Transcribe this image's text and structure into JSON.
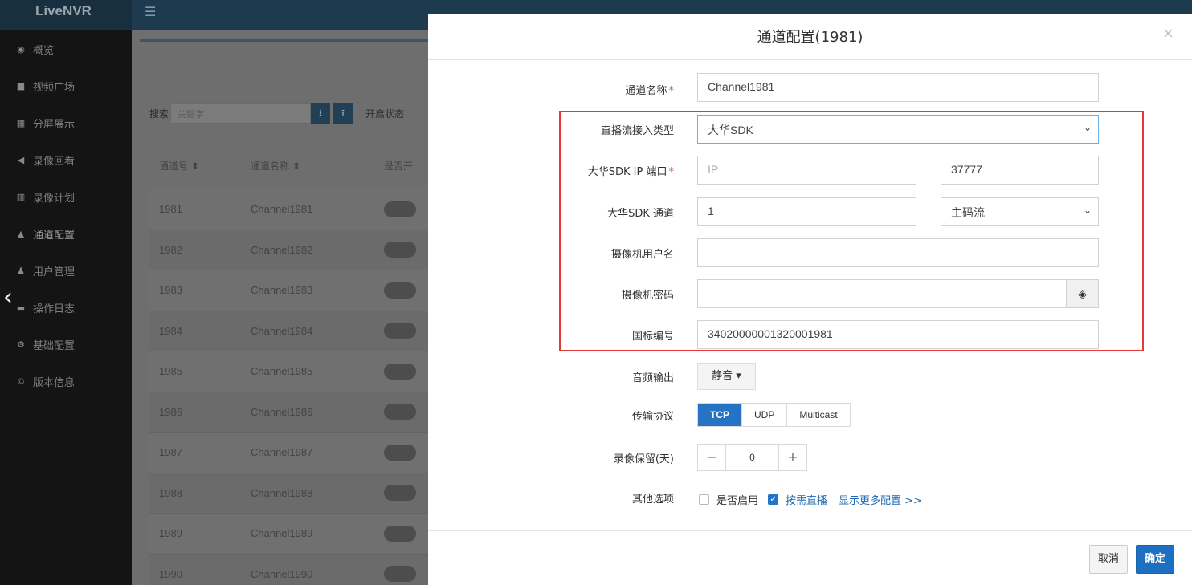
{
  "app": {
    "title": "LiveNVR",
    "menu_icon": "☰"
  },
  "sidebar": {
    "items": [
      {
        "label": "概览",
        "icon": "dashboard-icon",
        "glyph": "◉"
      },
      {
        "label": "视频广场",
        "icon": "video-camera-icon",
        "glyph": "■"
      },
      {
        "label": "分屏展示",
        "icon": "grid-icon",
        "glyph": "▦"
      },
      {
        "label": "录像回看",
        "icon": "backward-icon",
        "glyph": "◀"
      },
      {
        "label": "录像计划",
        "icon": "calendar-icon",
        "glyph": "▥"
      },
      {
        "label": "通道配置",
        "icon": "sitemap-icon",
        "glyph": "▲"
      },
      {
        "label": "用户管理",
        "icon": "users-icon",
        "glyph": "♟"
      },
      {
        "label": "操作日志",
        "icon": "file-icon",
        "glyph": "▬"
      },
      {
        "label": "基础配置",
        "icon": "gears-icon",
        "glyph": "⚙"
      },
      {
        "label": "版本信息",
        "icon": "copyright-icon",
        "glyph": "©"
      }
    ]
  },
  "toolbar": {
    "search_label": "搜索",
    "search_placeholder": "关键字",
    "download_icon": "⭳",
    "upload_icon": "⭱",
    "enable_label": "开启状态"
  },
  "table": {
    "headers": [
      "通道号 ⬍",
      "通道名称 ⬍",
      "是否开"
    ],
    "rows": [
      {
        "id": "1981",
        "name": "Channel1981"
      },
      {
        "id": "1982",
        "name": "Channel1982"
      },
      {
        "id": "1983",
        "name": "Channel1983"
      },
      {
        "id": "1984",
        "name": "Channel1984"
      },
      {
        "id": "1985",
        "name": "Channel1985"
      },
      {
        "id": "1986",
        "name": "Channel1986"
      },
      {
        "id": "1987",
        "name": "Channel1987"
      },
      {
        "id": "1988",
        "name": "Channel1988"
      },
      {
        "id": "1989",
        "name": "Channel1989"
      },
      {
        "id": "1990",
        "name": "Channel1990"
      }
    ]
  },
  "modal": {
    "title": "通道配置(1981)",
    "close": "×",
    "fields": {
      "channel_name": {
        "label": "通道名称",
        "required": "*",
        "value": "Channel1981"
      },
      "stream_type": {
        "label": "直播流接入类型",
        "value": "大华SDK"
      },
      "sdk_ip_port": {
        "label": "大华SDK IP 端口",
        "required": "*",
        "ip_placeholder": "IP",
        "port_value": "37777"
      },
      "sdk_channel": {
        "label": "大华SDK 通道",
        "value": "1",
        "stream_value": "主码流"
      },
      "camera_user": {
        "label": "摄像机用户名",
        "value": ""
      },
      "camera_password": {
        "label": "摄像机密码",
        "value": "",
        "eye_icon": "eye-slash-icon"
      },
      "gb_id": {
        "label": "国标编号",
        "value": "34020000001320001981"
      },
      "audio": {
        "label": "音频输出",
        "value": "静音 ▾"
      },
      "protocol": {
        "label": "传输协议",
        "options": [
          "TCP",
          "UDP",
          "Multicast"
        ],
        "selected": "TCP"
      },
      "record_keep": {
        "label": "录像保留(天)",
        "value": "0",
        "minus": "−",
        "plus": "+"
      },
      "other": {
        "label": "其他选项",
        "enabled_label": "是否启用",
        "enabled": false,
        "on_demand_label": "按需直播",
        "on_demand": true,
        "more_link": "显示更多配置 >>"
      }
    },
    "cancel_label": "取消",
    "ok_label": "确定"
  },
  "colors": {
    "primary": "#1c6fc1",
    "highlight": "#e53935",
    "required": "#d9534f"
  }
}
